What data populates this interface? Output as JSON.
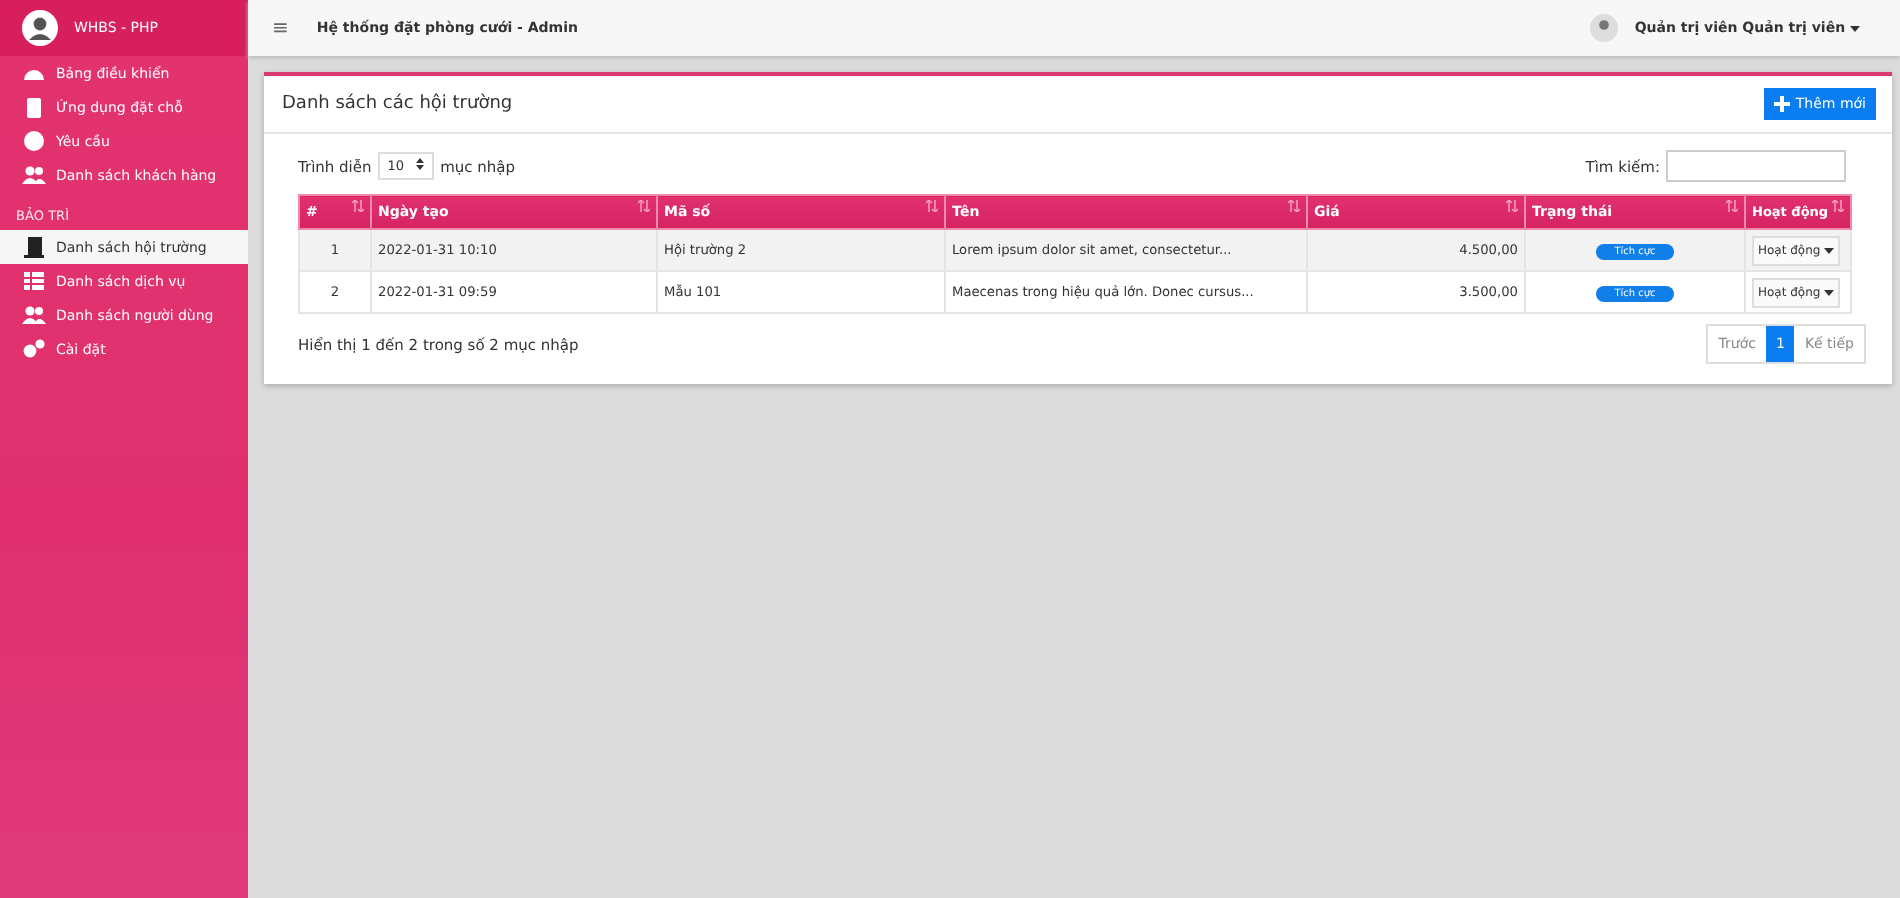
{
  "sidebar": {
    "brand": "WHBS - PHP",
    "items": [
      {
        "kind": "link",
        "label": "Bảng điều khiển",
        "selected": false
      },
      {
        "kind": "link",
        "label": "Ứng dụng đặt chỗ",
        "selected": false
      },
      {
        "kind": "link",
        "label": "Yêu cầu",
        "selected": false
      },
      {
        "kind": "link",
        "label": "Danh sách khách hàng",
        "selected": false
      },
      {
        "kind": "heading",
        "label": "BẢO TRÌ"
      },
      {
        "kind": "link",
        "label": "Danh sách hội trường",
        "selected": true
      },
      {
        "kind": "link",
        "label": "Danh sách dịch vụ",
        "selected": false
      },
      {
        "kind": "link",
        "label": "Danh sách người dùng",
        "selected": false
      },
      {
        "kind": "link",
        "label": "Cài đặt",
        "selected": false
      }
    ]
  },
  "topbar": {
    "menu_icon": "≡",
    "title": "Hệ thống đặt phòng cưới - Admin",
    "user": "Quản trị viên Quản trị viên"
  },
  "card": {
    "title": "Danh sách các hội trường",
    "add_button": "Thêm mới",
    "length": {
      "prefix": "Trình diễn",
      "value": "10",
      "suffix": "mục nhập"
    },
    "search": {
      "label": "Tìm kiếm:"
    },
    "table": {
      "columns": [
        "#",
        "Ngày tạo",
        "Mã số",
        "Tên",
        "Giá",
        "Trạng thái",
        "Hoạt động"
      ],
      "rows": [
        {
          "cells": [
            "1",
            "2022-01-31 10:10",
            "Hội trường 2",
            "Lorem ipsum dolor sit amet, consectetur...",
            "4.500,00"
          ],
          "status": "Tích cực",
          "action": "Hoạt động"
        },
        {
          "cells": [
            "2",
            "2022-01-31 09:59",
            "Mẫu 101",
            "Maecenas trong hiệu quả lớn. Donec cursus...",
            "3.500,00"
          ],
          "status": "Tích cực",
          "action": "Hoạt động"
        }
      ]
    },
    "info": "Hiển thị 1 đến 2 trong số 2 mục nhập",
    "pagination": [
      {
        "label": "Trước",
        "selected": false
      },
      {
        "label": "1",
        "selected": true
      },
      {
        "label": "Kế tiếp",
        "selected": false
      }
    ]
  }
}
